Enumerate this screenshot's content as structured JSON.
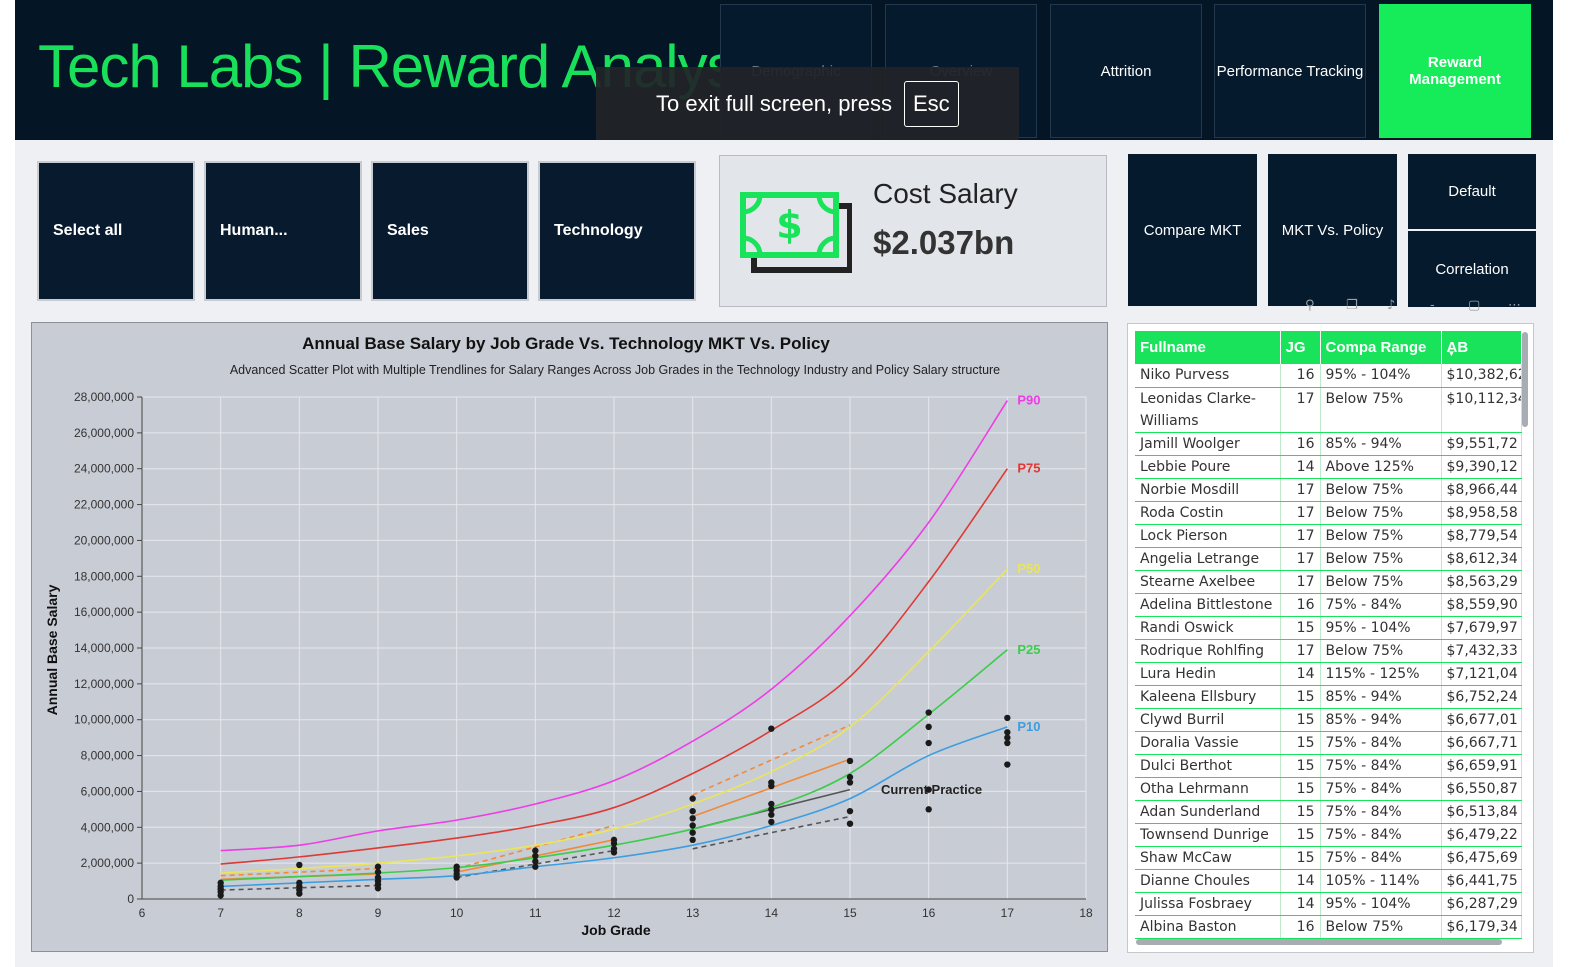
{
  "header": {
    "title": "Tech Labs | Reward Analysis",
    "nav": [
      {
        "label": "Demographic",
        "state": "dim"
      },
      {
        "label": "Overview",
        "state": "dim"
      },
      {
        "label": "Attrition",
        "state": "normal"
      },
      {
        "label": "Performance Tracking",
        "state": "normal"
      },
      {
        "label": "Reward Management",
        "state": "active"
      }
    ]
  },
  "fullscreen_toast": {
    "text": "To exit full screen, press",
    "key": "Esc"
  },
  "departments": [
    "Select all",
    "Human...",
    "Sales",
    "Technology"
  ],
  "kpi": {
    "label": "Cost Salary",
    "value": "$2.037bn",
    "icon": "money-bill-icon"
  },
  "view_buttons": {
    "compare_mkt": "Compare MKT",
    "mkt_vs_policy": "MKT Vs. Policy",
    "default": "Default",
    "correlation": "Correlation"
  },
  "colors": {
    "accent": "#19e35b",
    "navy": "#041526",
    "p90": "#ee3de6",
    "p75": "#de3a35",
    "p50": "#eae55a",
    "p25": "#3ccc4a",
    "p10": "#3c9ee0"
  },
  "chart_data": {
    "type": "scatter",
    "title": "Annual Base Salary by Job Grade Vs. Technology MKT Vs. Policy",
    "subtitle": "Advanced Scatter Plot with Multiple Trendlines for Salary Ranges Across Job Grades in the Technology Industry and Policy Salary structure",
    "xlabel": "Job Grade",
    "ylabel": "Annual Base Salary",
    "xlim": [
      6,
      18
    ],
    "ylim": [
      0,
      28000000
    ],
    "x_ticks": [
      6,
      7,
      8,
      9,
      10,
      11,
      12,
      13,
      14,
      15,
      16,
      17,
      18
    ],
    "y_ticks": [
      "0",
      "2,000,000",
      "4,000,000",
      "6,000,000",
      "8,000,000",
      "10,000,000",
      "12,000,000",
      "14,000,000",
      "16,000,000",
      "18,000,000",
      "20,000,000",
      "22,000,000",
      "24,000,000",
      "26,000,000",
      "28,000,000"
    ],
    "grid": true,
    "series": [
      {
        "name": "P90",
        "color": "#ee3de6",
        "x": [
          7,
          8,
          9,
          10,
          11,
          12,
          13,
          14,
          15,
          16,
          17
        ],
        "y": [
          2700000,
          3000000,
          3800000,
          4400000,
          5300000,
          6600000,
          8800000,
          11700000,
          15800000,
          21000000,
          27800000
        ]
      },
      {
        "name": "P75",
        "color": "#de3a35",
        "x": [
          7,
          8,
          9,
          10,
          11,
          12,
          13,
          14,
          15,
          16,
          17
        ],
        "y": [
          1950000,
          2350000,
          2850000,
          3400000,
          4100000,
          5100000,
          7000000,
          9400000,
          12400000,
          17700000,
          24000000
        ]
      },
      {
        "name": "P50",
        "color": "#eae55a",
        "x": [
          7,
          8,
          9,
          10,
          11,
          12,
          13,
          14,
          15,
          16,
          17
        ],
        "y": [
          1450000,
          1700000,
          2000000,
          2400000,
          3000000,
          3900000,
          5300000,
          7100000,
          9600000,
          13800000,
          18400000
        ]
      },
      {
        "name": "P25",
        "color": "#3ccc4a",
        "x": [
          7,
          8,
          9,
          10,
          11,
          12,
          13,
          14,
          15,
          16,
          17
        ],
        "y": [
          1050000,
          1250000,
          1450000,
          1750000,
          2300000,
          3000000,
          3900000,
          5100000,
          7000000,
          10300000,
          13900000
        ]
      },
      {
        "name": "P10",
        "color": "#3c9ee0",
        "x": [
          7,
          8,
          9,
          10,
          11,
          12,
          13,
          14,
          15,
          16,
          17
        ],
        "y": [
          700000,
          900000,
          1100000,
          1300000,
          1800000,
          2300000,
          3000000,
          4100000,
          5600000,
          8000000,
          9600000
        ]
      }
    ],
    "policy_bands": [
      {
        "x": [
          7,
          9
        ],
        "y": [
          1300000,
          1700000
        ],
        "color": "#f08a3a",
        "dash": true
      },
      {
        "x": [
          7,
          9
        ],
        "y": [
          1100000,
          1400000
        ],
        "color": "#f08a3a",
        "dash": false
      },
      {
        "x": [
          7,
          9
        ],
        "y": [
          500000,
          750000
        ],
        "color": "#555555",
        "dash": true
      },
      {
        "x": [
          10,
          12
        ],
        "y": [
          1700000,
          4100000
        ],
        "color": "#f08a3a",
        "dash": true
      },
      {
        "x": [
          10,
          12
        ],
        "y": [
          1500000,
          3300000
        ],
        "color": "#f08a3a",
        "dash": false
      },
      {
        "x": [
          10,
          12
        ],
        "y": [
          1200000,
          2700000
        ],
        "color": "#555555",
        "dash": true
      },
      {
        "x": [
          13,
          15
        ],
        "y": [
          5800000,
          9700000
        ],
        "color": "#f08a3a",
        "dash": true
      },
      {
        "x": [
          13,
          15
        ],
        "y": [
          4600000,
          7800000
        ],
        "color": "#f08a3a",
        "dash": false
      },
      {
        "x": [
          13,
          15
        ],
        "y": [
          3900000,
          6100000
        ],
        "color": "#555555",
        "dash": false
      },
      {
        "x": [
          13,
          15
        ],
        "y": [
          2800000,
          4600000
        ],
        "color": "#555555",
        "dash": true
      }
    ],
    "points": [
      [
        7,
        200000
      ],
      [
        7,
        400000
      ],
      [
        7,
        550000
      ],
      [
        7,
        700000
      ],
      [
        7,
        900000
      ],
      [
        8,
        300000
      ],
      [
        8,
        500000
      ],
      [
        8,
        700000
      ],
      [
        8,
        900000
      ],
      [
        8,
        1900000
      ],
      [
        9,
        600000
      ],
      [
        9,
        800000
      ],
      [
        9,
        1000000
      ],
      [
        9,
        1200000
      ],
      [
        9,
        1500000
      ],
      [
        9,
        1800000
      ],
      [
        10,
        1200000
      ],
      [
        10,
        1400000
      ],
      [
        10,
        1600000
      ],
      [
        10,
        1800000
      ],
      [
        11,
        1800000
      ],
      [
        11,
        2100000
      ],
      [
        11,
        2400000
      ],
      [
        11,
        2700000
      ],
      [
        12,
        2600000
      ],
      [
        12,
        2800000
      ],
      [
        12,
        3100000
      ],
      [
        12,
        3300000
      ],
      [
        13,
        3300000
      ],
      [
        13,
        3700000
      ],
      [
        13,
        4100000
      ],
      [
        13,
        4500000
      ],
      [
        13,
        4900000
      ],
      [
        13,
        5600000
      ],
      [
        14,
        4300000
      ],
      [
        14,
        4700000
      ],
      [
        14,
        5000000
      ],
      [
        14,
        5300000
      ],
      [
        14,
        6300000
      ],
      [
        14,
        6500000
      ],
      [
        14,
        9500000
      ],
      [
        15,
        4200000
      ],
      [
        15,
        4900000
      ],
      [
        15,
        6500000
      ],
      [
        15,
        6800000
      ],
      [
        15,
        7700000
      ],
      [
        16,
        5000000
      ],
      [
        16,
        6100000
      ],
      [
        16,
        8700000
      ],
      [
        16,
        9600000
      ],
      [
        16,
        10400000
      ],
      [
        17,
        7500000
      ],
      [
        17,
        8700000
      ],
      [
        17,
        9000000
      ],
      [
        17,
        9300000
      ],
      [
        17,
        10100000
      ]
    ],
    "annotation": "Current Practice"
  },
  "table": {
    "columns": [
      "Fullname",
      "JG",
      "Compa Range",
      "AB"
    ],
    "sort_indicator": "▼",
    "rows": [
      [
        "Niko Purvess",
        "16",
        "95% - 104%",
        "$10,382,62"
      ],
      [
        "Leonidas Clarke-Williams",
        "17",
        "Below 75%",
        "$10,112,34"
      ],
      [
        "Jamill Woolger",
        "16",
        "85% - 94%",
        "$9,551,72"
      ],
      [
        "Lebbie Poure",
        "14",
        "Above 125%",
        "$9,390,12"
      ],
      [
        "Norbie Mosdill",
        "17",
        "Below 75%",
        "$8,966,44"
      ],
      [
        "Roda Costin",
        "17",
        "Below 75%",
        "$8,958,58"
      ],
      [
        "Lock Pierson",
        "17",
        "Below 75%",
        "$8,779,54"
      ],
      [
        "Angelia Letrange",
        "17",
        "Below 75%",
        "$8,612,34"
      ],
      [
        "Stearne Axelbee",
        "17",
        "Below 75%",
        "$8,563,29"
      ],
      [
        "Adelina Bittlestone",
        "16",
        "75% - 84%",
        "$8,559,90"
      ],
      [
        "Randi Oswick",
        "15",
        "95% - 104%",
        "$7,679,97"
      ],
      [
        "Rodrique Rohlfing",
        "17",
        "Below 75%",
        "$7,432,33"
      ],
      [
        "Lura Hedin",
        "14",
        "115% - 125%",
        "$7,121,04"
      ],
      [
        "Kaleena Ellsbury",
        "15",
        "85% - 94%",
        "$6,752,24"
      ],
      [
        "Clywd Burril",
        "15",
        "85% - 94%",
        "$6,677,01"
      ],
      [
        "Doralia Vassie",
        "15",
        "75% - 84%",
        "$6,667,71"
      ],
      [
        "Dulci Berthot",
        "15",
        "75% - 84%",
        "$6,659,91"
      ],
      [
        "Otha Lehrmann",
        "15",
        "75% - 84%",
        "$6,550,87"
      ],
      [
        "Adan Sunderland",
        "15",
        "75% - 84%",
        "$6,513,84"
      ],
      [
        "Townsend Dunrige",
        "15",
        "75% - 84%",
        "$6,479,22"
      ],
      [
        "Shaw McCaw",
        "15",
        "75% - 84%",
        "$6,475,69"
      ],
      [
        "Dianne Choules",
        "14",
        "105% - 114%",
        "$6,441,75"
      ],
      [
        "Julissa Fosbraey",
        "14",
        "95% - 104%",
        "$6,287,29"
      ],
      [
        "Albina Baston",
        "16",
        "Below 75%",
        "$6,179,34"
      ]
    ]
  }
}
